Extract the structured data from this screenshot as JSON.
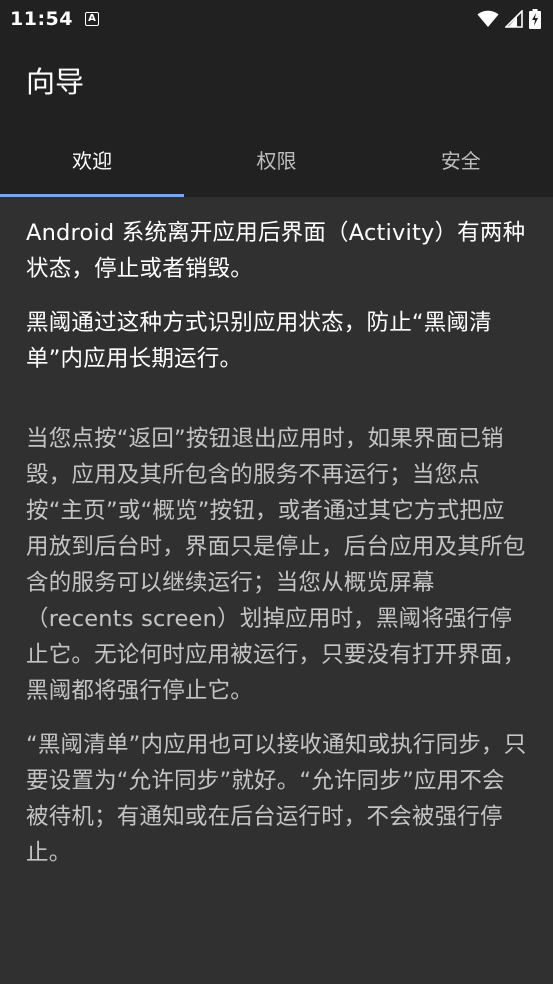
{
  "status_bar": {
    "time": "11:54",
    "notification_icon": "a-letter-icon",
    "icons": [
      "wifi-icon",
      "cell-signal-icon",
      "battery-charging-icon"
    ]
  },
  "app_bar": {
    "title": "向导"
  },
  "tabs": [
    {
      "label": "欢迎",
      "active": true
    },
    {
      "label": "权限",
      "active": false
    },
    {
      "label": "安全",
      "active": false
    }
  ],
  "content": {
    "paragraphs": [
      "Android 系统离开应用后界面（Activity）有两种状态，停止或者销毁。",
      "黑阈通过这种方式识别应用状态，防止“黑阈清单”内应用长期运行。",
      "当您点按“返回”按钮退出应用时，如果界面已销毁，应用及其所包含的服务不再运行；当您点按“主页”或“概览”按钮，或者通过其它方式把应用放到后台时，界面只是停止，后台应用及其所包含的服务可以继续运行；当您从概览屏幕（recents screen）划掉应用时，黑阈将强行停止它。无论何时应用被运行，只要没有打开界面，黑阈都将强行停止它。",
      "“黑阈清单”内应用也可以接收通知或执行同步，只要设置为“允许同步”就好。“允许同步”应用不会被待机；有通知或在后台运行时，不会被强行停止。"
    ]
  },
  "colors": {
    "background": "#303030",
    "bars": "#212121",
    "accent": "#7aa7ec",
    "secondary_text": "#c4c4c4"
  }
}
